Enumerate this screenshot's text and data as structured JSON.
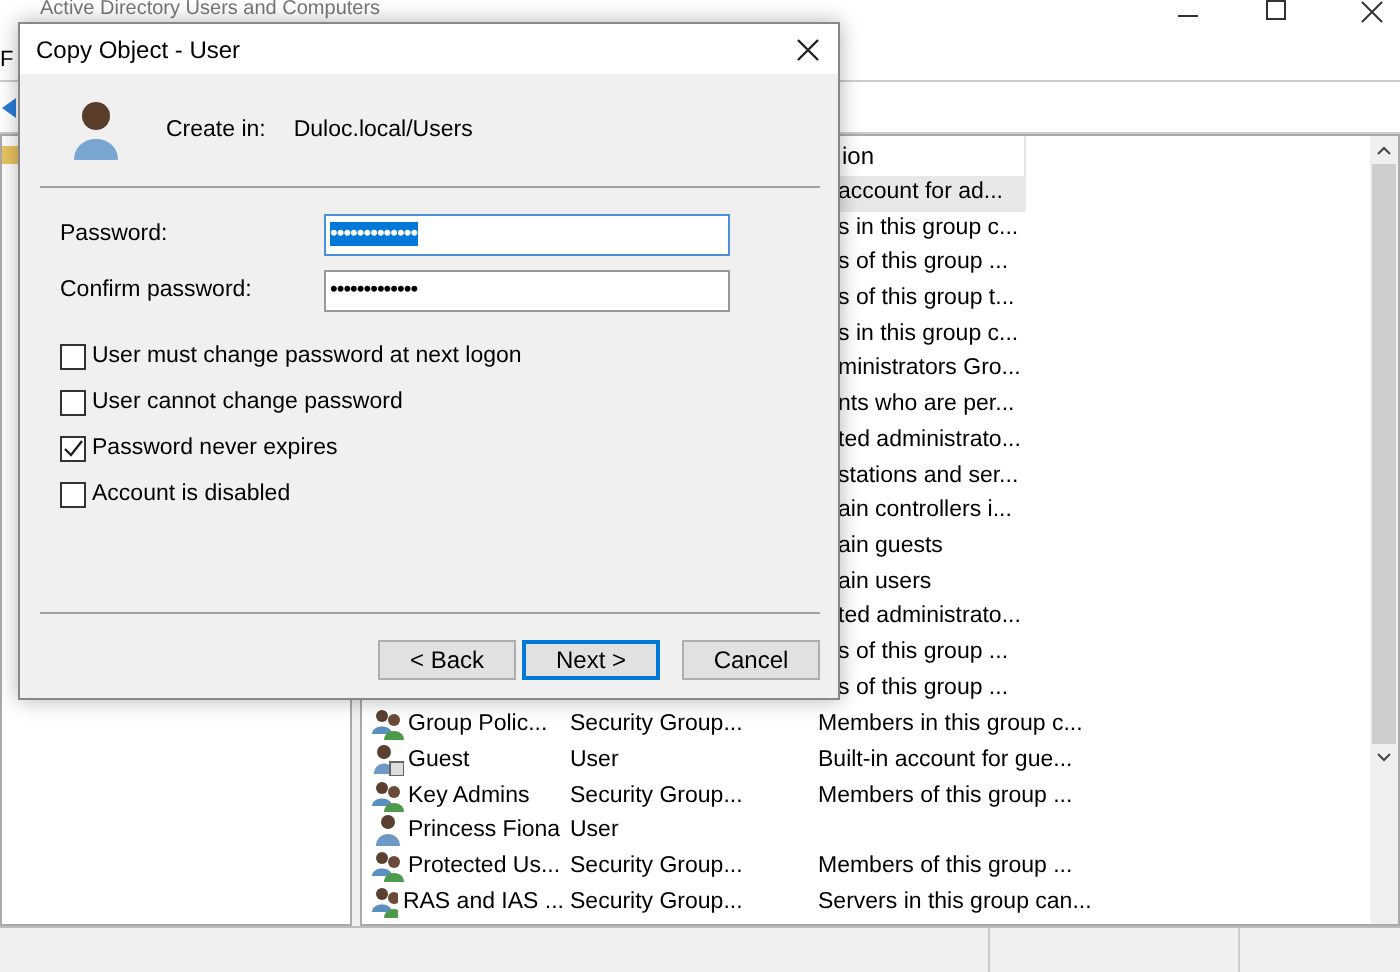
{
  "window": {
    "title": "Active Directory Users and Computers"
  },
  "menu": [
    "F"
  ],
  "list": {
    "header": "ion",
    "rows": [
      {
        "kind": "partial",
        "description": "account for ad...",
        "selected": true
      },
      {
        "kind": "partial",
        "description": "s in this group c...",
        "selected": false
      },
      {
        "kind": "partial",
        "description": "s of this group ...",
        "selected": false
      },
      {
        "kind": "partial",
        "description": "s of this group t...",
        "selected": false
      },
      {
        "kind": "partial",
        "description": "s in this group c...",
        "selected": false
      },
      {
        "kind": "partial",
        "description": "ministrators Gro...",
        "selected": false
      },
      {
        "kind": "partial",
        "description": "nts who are per...",
        "selected": false
      },
      {
        "kind": "partial",
        "description": "ted administrato...",
        "selected": false
      },
      {
        "kind": "partial",
        "description": "stations and ser...",
        "selected": false
      },
      {
        "kind": "partial",
        "description": "ain controllers i...",
        "selected": false
      },
      {
        "kind": "partial",
        "description": "ain guests",
        "selected": false
      },
      {
        "kind": "partial",
        "description": "ain users",
        "selected": false
      },
      {
        "kind": "partial",
        "description": "ted administrato...",
        "selected": false
      },
      {
        "kind": "partial",
        "description": "s of this group ...",
        "selected": false
      },
      {
        "kind": "partial",
        "description": "s of this group ...",
        "selected": false
      },
      {
        "kind": "group",
        "name": "Group Polic...",
        "type": "Security Group...",
        "description": "Members in this group c...",
        "selected": false
      },
      {
        "kind": "guest",
        "name": "Guest",
        "type": "User",
        "description": "Built-in account for gue...",
        "selected": false
      },
      {
        "kind": "group",
        "name": "Key Admins",
        "type": "Security Group...",
        "description": "Members of this group ...",
        "selected": false
      },
      {
        "kind": "user",
        "name": "Princess Fiona",
        "type": "User",
        "selected": false
      },
      {
        "kind": "group",
        "name": "Protected Us...",
        "type": "Security Group...",
        "description": "Members of this group ...",
        "selected": false
      },
      {
        "kind": "group",
        "name": "RAS and IAS ...",
        "type": "Security Group...",
        "description": "Servers in this group can...",
        "selected": false
      }
    ]
  },
  "dialog": {
    "title": "Copy Object - User",
    "create_in_label": "Create in:",
    "create_in_value": "Duloc.local/Users",
    "fields": [
      {
        "label": "Password:",
        "value": "•••••••••••••",
        "focused": true
      },
      {
        "label": "Confirm password:",
        "value": "•••••••••••••",
        "focused": false
      }
    ],
    "options": [
      {
        "label": "User must change password at next logon",
        "checked": false
      },
      {
        "label": "User cannot change password",
        "checked": false
      },
      {
        "label": "Password never expires",
        "checked": true
      },
      {
        "label": "Account is disabled",
        "checked": false
      }
    ],
    "buttons": [
      {
        "label": "< Back",
        "default": false
      },
      {
        "label": "Next >",
        "default": true
      },
      {
        "label": "Cancel",
        "default": false
      }
    ]
  }
}
